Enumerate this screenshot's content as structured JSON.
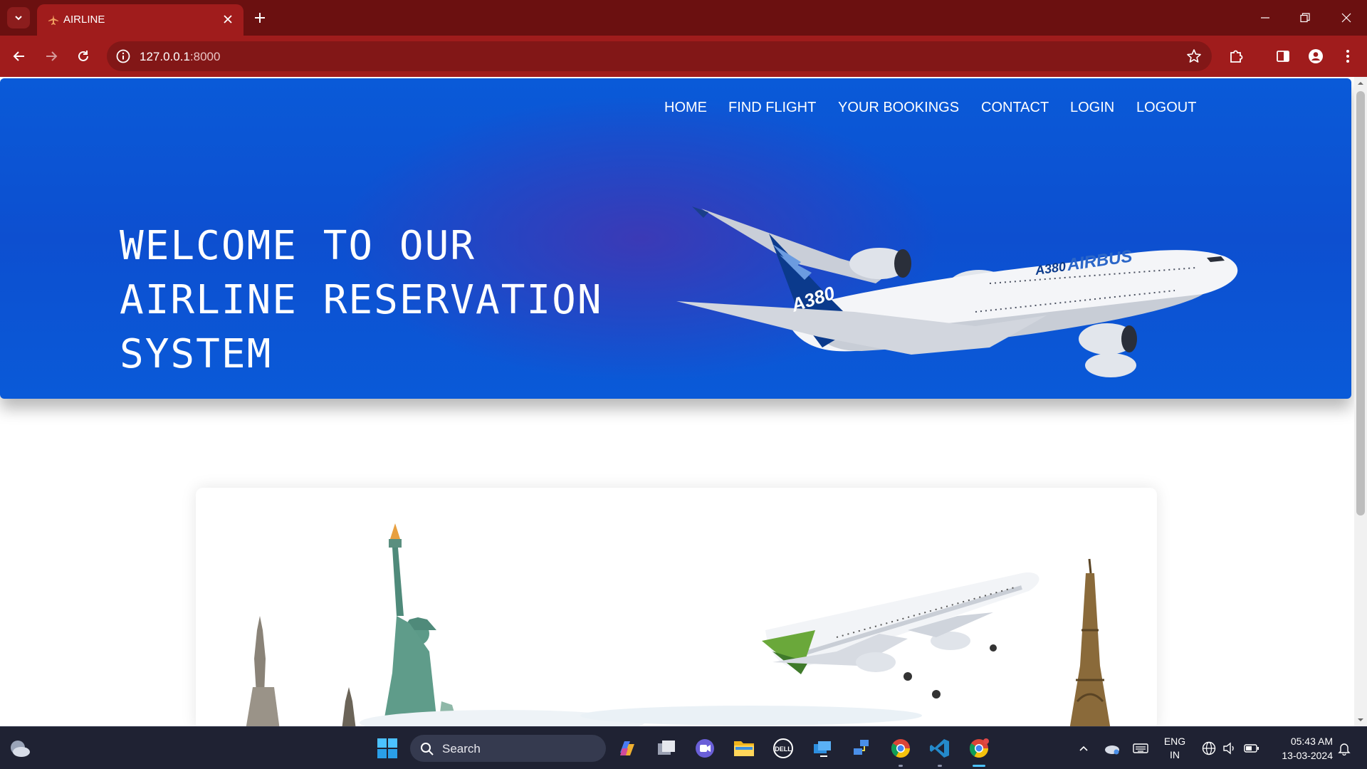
{
  "browser": {
    "tab_title": "AIRLINE",
    "url_host": "127.0.0.1",
    "url_port": ":8000",
    "theme_color": "#a01c1c"
  },
  "nav": {
    "items": [
      {
        "label": "HOME"
      },
      {
        "label": "FIND FLIGHT"
      },
      {
        "label": "YOUR BOOKINGS"
      },
      {
        "label": "CONTACT"
      },
      {
        "label": "LOGIN"
      },
      {
        "label": "LOGOUT"
      }
    ]
  },
  "hero": {
    "title_lines": [
      "WELCOME TO OUR",
      "AIRLINE RESERVATION",
      "SYSTEM"
    ],
    "plane_text": {
      "model": "A380",
      "brand": "AIRBUS",
      "tail": "A380"
    },
    "background": "#0a5ad8"
  },
  "taskbar": {
    "search_label": "Search",
    "lang_line1": "ENG",
    "lang_line2": "IN",
    "time": "05:43 AM",
    "date": "13-03-2024"
  }
}
